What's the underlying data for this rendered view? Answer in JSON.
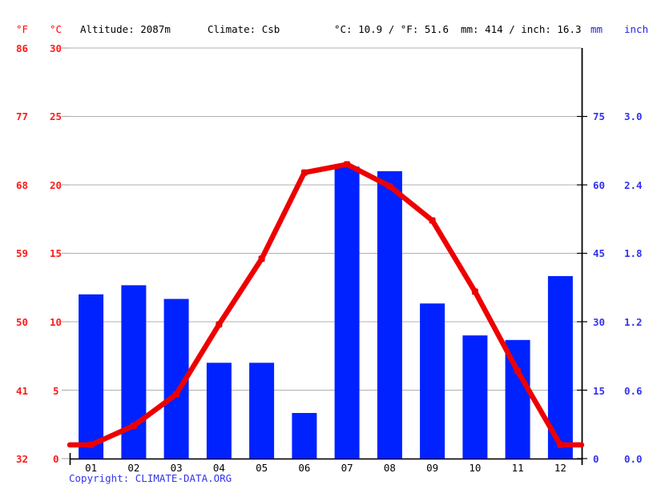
{
  "header": {
    "unit_f": "°F",
    "unit_c": "°C",
    "altitude": "Altitude: 2087m",
    "climate": "Climate: Csb",
    "avg_temp": "°C: 10.9 / °F: 51.6",
    "avg_precip": "mm: 414 / inch: 16.3",
    "unit_mm": "mm",
    "unit_inch": "inch"
  },
  "axes": {
    "left_f": {
      "label": "°F",
      "ticks": [
        "86",
        "77",
        "68",
        "59",
        "50",
        "41",
        "32"
      ],
      "color": "#ff1a1a"
    },
    "left_c": {
      "label": "°C",
      "ticks": [
        "30",
        "25",
        "20",
        "15",
        "10",
        "5",
        "0"
      ],
      "color": "#ff1a1a"
    },
    "right_mm": {
      "label": "mm",
      "ticks": [
        "",
        "75",
        "60",
        "45",
        "30",
        "15",
        "0"
      ],
      "color": "#3333ee"
    },
    "right_inch": {
      "label": "inch",
      "ticks": [
        "",
        "3.0",
        "2.4",
        "1.8",
        "1.2",
        "0.6",
        "0.0"
      ],
      "color": "#3333ee"
    }
  },
  "footer": {
    "copyright": "Copyright: CLIMATE-DATA.ORG"
  },
  "chart_data": {
    "type": "bar",
    "title": "",
    "subtitle": "",
    "xlabel": "",
    "ylabel": "",
    "grid": true,
    "legend": "none",
    "categories": [
      "01",
      "02",
      "03",
      "04",
      "05",
      "06",
      "07",
      "08",
      "09",
      "10",
      "11",
      "12"
    ],
    "series": [
      {
        "name": "Precipitation",
        "type": "bar",
        "unit": "mm",
        "color": "#0022ff",
        "axis": "right",
        "ylim": [
          0,
          90
        ],
        "values": [
          36,
          38,
          35,
          21,
          21,
          10,
          64,
          63,
          34,
          27,
          26,
          40
        ]
      },
      {
        "name": "Temperature",
        "type": "line",
        "unit": "°C",
        "color": "#ee0000",
        "axis": "left",
        "ylim": [
          0,
          30
        ],
        "values": [
          1.0,
          2.4,
          4.7,
          9.8,
          14.6,
          20.9,
          21.5,
          19.9,
          17.4,
          12.2,
          6.4,
          1.0
        ]
      }
    ]
  }
}
